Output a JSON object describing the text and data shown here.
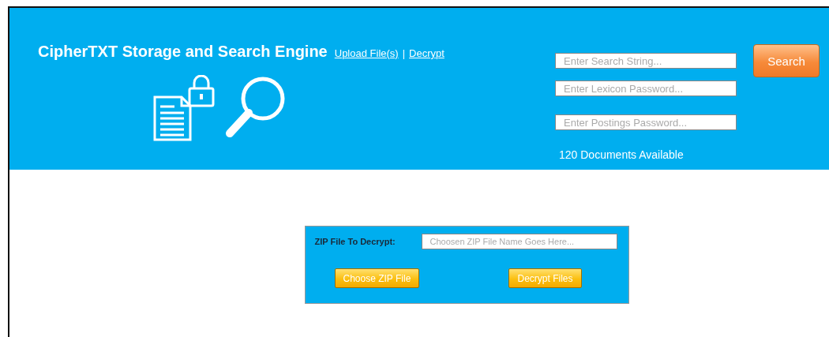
{
  "header": {
    "title": "CipherTXT Storage and Search Engine",
    "links": [
      "Upload File(s)",
      "Decrypt"
    ],
    "link_separator": "|",
    "fields": [
      {
        "placeholder": "Enter Search String..."
      },
      {
        "placeholder": "Enter Lexicon Password..."
      },
      {
        "placeholder": "Enter Postings Password..."
      }
    ],
    "search_button": "Search",
    "document_count": "120 Documents Available"
  },
  "decrypt_panel": {
    "label": "ZIP File To Decrypt:",
    "file_field": {
      "placeholder": "Choosen ZIP File Name Goes Here..."
    },
    "buttons": [
      "Choose ZIP File",
      "Decrypt Files"
    ]
  }
}
